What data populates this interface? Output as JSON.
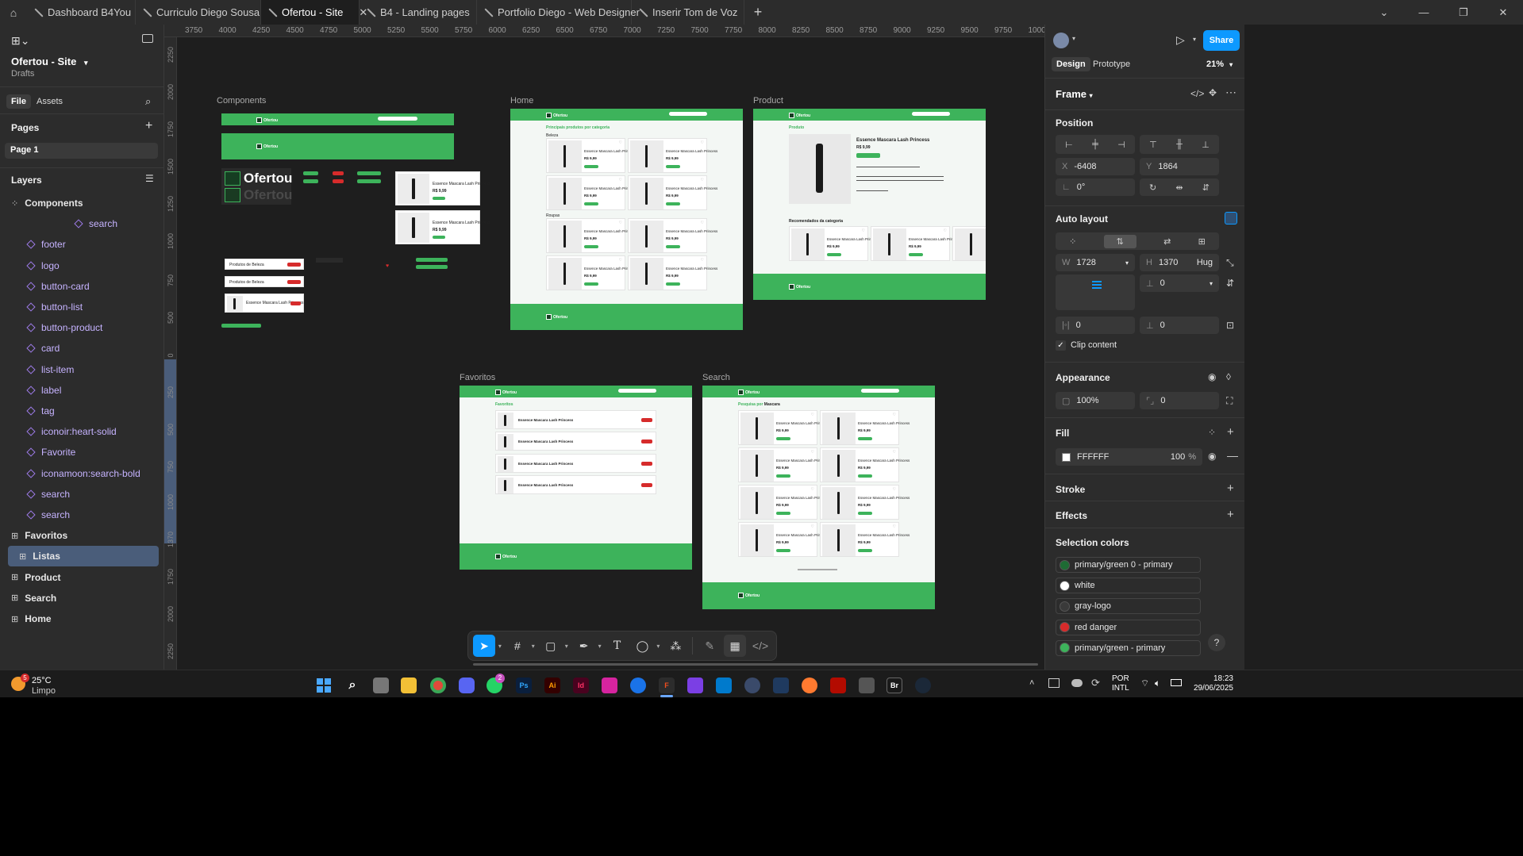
{
  "tabs": [
    {
      "label": "Dashboard B4You"
    },
    {
      "label": "Curriculo Diego Sousa"
    },
    {
      "label": "Ofertou - Site",
      "active": true
    },
    {
      "label": "B4 - Landing pages"
    },
    {
      "label": "Portfolio Diego - Web Designer"
    },
    {
      "label": "Inserir Tom de Voz"
    }
  ],
  "file": {
    "name": "Ofertou - Site",
    "location": "Drafts"
  },
  "left_tabs": {
    "file": "File",
    "assets": "Assets"
  },
  "pages": {
    "title": "Pages",
    "items": [
      "Page 1"
    ]
  },
  "layers": {
    "title": "Layers",
    "items": [
      {
        "label": "Components",
        "type": "section"
      },
      {
        "label": "search",
        "type": "component"
      },
      {
        "label": "footer",
        "type": "component"
      },
      {
        "label": "logo",
        "type": "component"
      },
      {
        "label": "button-card",
        "type": "component"
      },
      {
        "label": "button-list",
        "type": "component"
      },
      {
        "label": "button-product",
        "type": "component"
      },
      {
        "label": "card",
        "type": "component"
      },
      {
        "label": "list-item",
        "type": "component"
      },
      {
        "label": "label",
        "type": "component"
      },
      {
        "label": "tag",
        "type": "component"
      },
      {
        "label": "iconoir:heart-solid",
        "type": "component"
      },
      {
        "label": "Favorite",
        "type": "component"
      },
      {
        "label": "iconamoon:search-bold",
        "type": "component"
      },
      {
        "label": "search",
        "type": "component"
      },
      {
        "label": "search",
        "type": "component"
      },
      {
        "label": "Favoritos",
        "type": "frame"
      },
      {
        "label": "Listas",
        "type": "frame",
        "selected": true
      },
      {
        "label": "Product",
        "type": "frame"
      },
      {
        "label": "Search",
        "type": "frame"
      },
      {
        "label": "Home",
        "type": "frame"
      }
    ]
  },
  "ruler_top": [
    "3750",
    "4000",
    "4250",
    "4500",
    "4750",
    "5000",
    "5250",
    "5500",
    "5750",
    "6000",
    "6250",
    "6500",
    "6750",
    "7000",
    "7250",
    "7500",
    "7750",
    "8000",
    "8250",
    "8500",
    "8750",
    "9000",
    "9250",
    "9500",
    "9750",
    "10000"
  ],
  "ruler_left": [
    "2250",
    "2000",
    "1750",
    "1500",
    "1250",
    "1000",
    "750",
    "500",
    "0",
    "250",
    "500",
    "750",
    "1000",
    "1370",
    "1750",
    "2000",
    "2250"
  ],
  "canvas": {
    "frames": {
      "components": "Components",
      "home": "Home",
      "product": "Product",
      "favoritos": "Favoritos",
      "search": "Search"
    },
    "brand": "Ofertou",
    "home_heading": "Principais produtos por categoria",
    "home_cat1": "Beleza",
    "home_cat2": "Roupas",
    "product_heading": "Produto",
    "product_name": "Essence Mascara Lash Princess",
    "product_reco": "Recomendados da categoria",
    "fav_heading": "Favoritos",
    "search_heading": "Pesquisa por",
    "search_term": "Mascara",
    "card_name": "Essence Mascara Lash Princess",
    "card_price": "R$ 9,99",
    "list_title": "Produtos de Beleza"
  },
  "toolbar": {
    "tools": [
      "move-tool",
      "frame-tool",
      "shape-tool",
      "pen-tool",
      "text-tool",
      "comment-tool",
      "actions-tool",
      "draw-tool",
      "dev-tool",
      "code-tool"
    ]
  },
  "right": {
    "share": "Share",
    "tabs": {
      "design": "Design",
      "prototype": "Prototype"
    },
    "zoom": "21%",
    "frame_label": "Frame",
    "position": {
      "title": "Position",
      "x": "-6408",
      "y": "1864",
      "rotation": "0°"
    },
    "autolayout": {
      "title": "Auto layout",
      "w": "1728",
      "h": "1370",
      "h_mode": "Hug",
      "gap": "0",
      "pad_h": "0",
      "pad_v": "0",
      "clip": "Clip content"
    },
    "appearance": {
      "title": "Appearance",
      "opacity": "100%",
      "radius": "0"
    },
    "fill": {
      "title": "Fill",
      "hex": "FFFFFF",
      "opacity": "100",
      "unit": "%"
    },
    "stroke": {
      "title": "Stroke"
    },
    "effects": {
      "title": "Effects"
    },
    "selection_colors": {
      "title": "Selection colors",
      "items": [
        {
          "name": "primary/green 0 - primary",
          "color": "#1e6b34"
        },
        {
          "name": "white",
          "color": "#ffffff"
        },
        {
          "name": "gray-logo",
          "color": "#3a3a3a"
        },
        {
          "name": "red danger",
          "color": "#d62b2b"
        },
        {
          "name": "primary/green - primary",
          "color": "#3db35b"
        }
      ]
    }
  },
  "taskbar": {
    "weather_temp": "25°C",
    "weather_desc": "Limpo",
    "weather_badge": "5",
    "whatsapp_badge": "2",
    "lang1": "POR",
    "lang2": "INTL",
    "time": "18:23",
    "date": "29/06/2025"
  }
}
